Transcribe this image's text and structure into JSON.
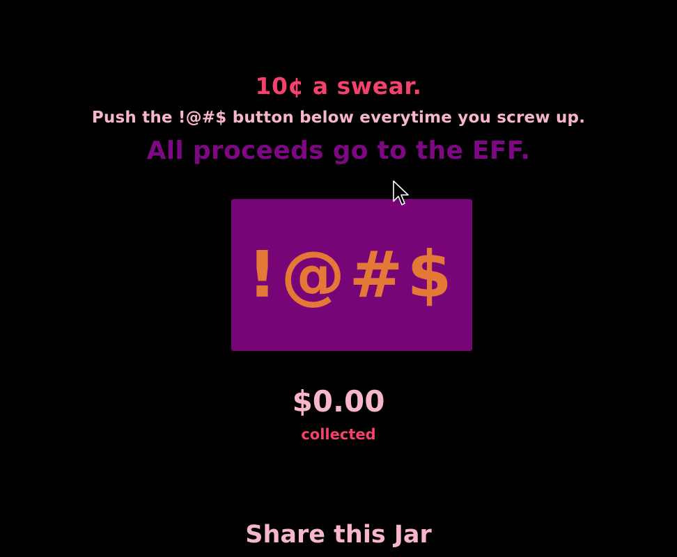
{
  "header": {
    "price_line": "10¢ a swear.",
    "instruction": "Push the !@#$ button below everytime you screw up.",
    "proceeds": "All proceeds go to the EFF."
  },
  "swear_button": {
    "label": "!@#$"
  },
  "total": {
    "amount": "$0.00",
    "caption": "collected"
  },
  "share": {
    "heading": "Share this Jar"
  },
  "colors": {
    "background": "#000000",
    "accent_red": "#f5416c",
    "pink": "#f8b6c9",
    "purple": "#780578",
    "orange": "#e37837"
  },
  "icons": {
    "cursor": "mouse-pointer-icon"
  }
}
